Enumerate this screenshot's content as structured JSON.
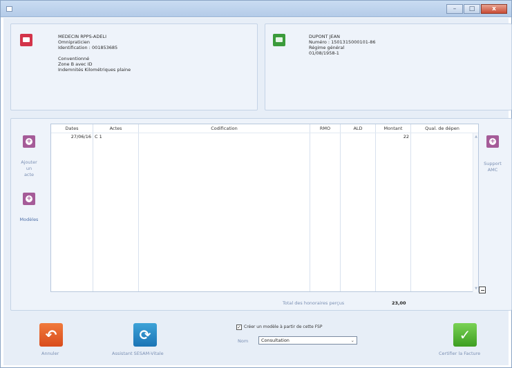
{
  "window": {
    "controls": {
      "minimize": "–",
      "maximize": "□",
      "close": "x"
    }
  },
  "doctor": {
    "icon": "card-icon",
    "lines": [
      "MEDECIN RPPS-ADELI",
      "Omnipraticien",
      "Identification : 001853685",
      "",
      "Conventionné",
      "Zone B avec ID",
      "Indemnités Kilométriques plaine"
    ]
  },
  "patient": {
    "icon": "vitale-card-icon",
    "lines": [
      "DUPONT JEAN",
      "Numéro : 1501315000101-86",
      "Régime général",
      "01/08/1958-1"
    ]
  },
  "left_actions": {
    "add_act": "Ajouter\nun\nacte",
    "models": "Modèles"
  },
  "right_actions": {
    "support_amc": "Support\nAMC"
  },
  "table": {
    "columns": [
      "Dates",
      "Actes",
      "Codification",
      "RMO",
      "ALD",
      "Montant",
      "Qual. de dépen"
    ],
    "rows": [
      {
        "date": "27/06/16",
        "acte": "C 1",
        "codification": "",
        "rmo": "",
        "ald": "",
        "montant": "22",
        "qual": ""
      }
    ]
  },
  "total": {
    "label": "Total des honoraires perçus",
    "value": "23,00"
  },
  "bottom": {
    "cancel": "Annuler",
    "assistant": "Assistant SESAM-Vitale",
    "create_model": "Créer un modèle à partir de cette FSP",
    "checkbox_mark": "✓",
    "name_label": "Nom",
    "name_value": "Consultation",
    "certify": "Certifier la Facture"
  },
  "colors": {
    "doctor_tile": "#d3344a",
    "patient_tile": "#3b9b3b",
    "action_tile": "#a55b98",
    "cancel_icon": "#e5602b",
    "assistant_icon": "#2d8cc8",
    "certify_icon": "#5cbd3b"
  }
}
